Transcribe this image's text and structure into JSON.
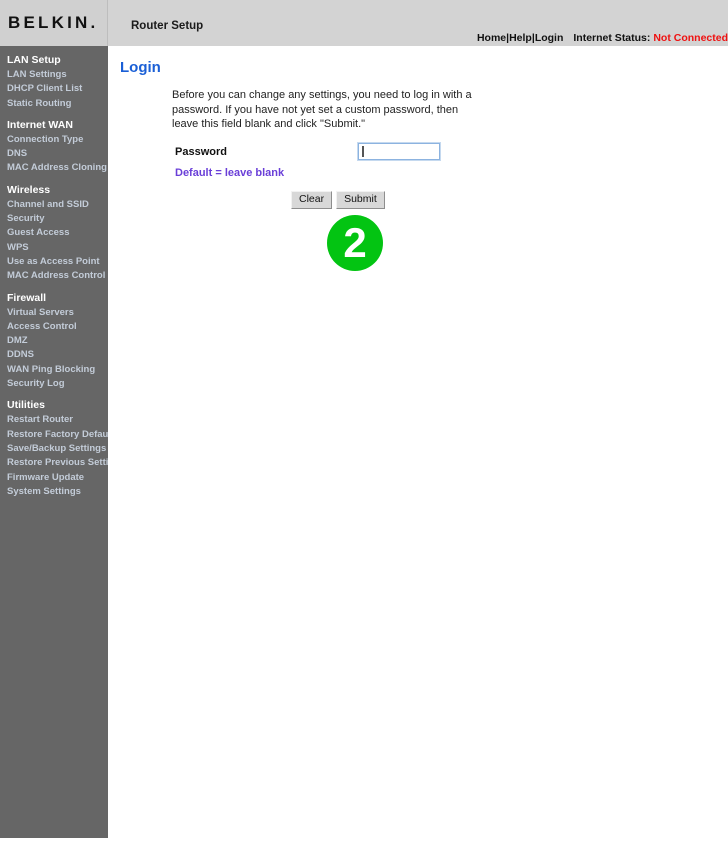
{
  "header": {
    "logo": "BELKIN.",
    "app_title": "Router Setup",
    "links": [
      {
        "label": "Home",
        "name": "home"
      },
      {
        "label": "Help",
        "name": "help"
      },
      {
        "label": "Login",
        "name": "login"
      }
    ],
    "separator": "|",
    "internet_status_label": "Internet Status:",
    "internet_status_value": "Not Connected",
    "status_color": "#ef1111"
  },
  "sidebar": {
    "groups": [
      {
        "header": "LAN Setup",
        "items": [
          "LAN Settings",
          "DHCP Client List",
          "Static Routing"
        ]
      },
      {
        "header": "Internet WAN",
        "items": [
          "Connection Type",
          "DNS",
          "MAC Address Cloning"
        ]
      },
      {
        "header": "Wireless",
        "items": [
          "Channel and SSID",
          "Security",
          "Guest Access",
          "WPS",
          "Use as Access Point",
          "MAC Address Control"
        ]
      },
      {
        "header": "Firewall",
        "items": [
          "Virtual Servers",
          "Access Control",
          "DMZ",
          "DDNS",
          "WAN Ping Blocking",
          "Security Log"
        ]
      },
      {
        "header": "Utilities",
        "items": [
          "Restart Router",
          "Restore Factory Default",
          "Save/Backup Settings",
          "Restore Previous Settings",
          "Firmware Update",
          "System Settings"
        ]
      }
    ]
  },
  "main": {
    "page_title": "Login",
    "intro": "Before you can change any settings, you need to log in with a password. If you have not yet set a custom password, then leave this field blank and click \"Submit.\"",
    "password_label": "Password",
    "password_value": "",
    "password_placeholder": "",
    "default_note": "Default = leave blank",
    "clear_button": "Clear",
    "submit_button": "Submit",
    "step_badge": "2",
    "step_badge_color": "#03c412"
  }
}
